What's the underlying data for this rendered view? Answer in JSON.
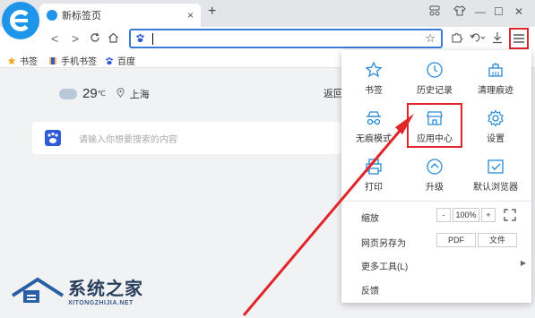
{
  "tab": {
    "title": "新标签页",
    "close": "×"
  },
  "new_tab": "+",
  "window_controls": [
    "⚇",
    "👕",
    "—",
    "☐",
    "✕"
  ],
  "nav": {
    "back": "<",
    "forward": ">",
    "refresh": "C",
    "home": "⌂",
    "star": "☆"
  },
  "bookmarks": [
    "书签",
    "手机书签",
    "百度"
  ],
  "weather": {
    "temp": "29",
    "unit": "℃",
    "city": "上海"
  },
  "page": {
    "back_label": "返回",
    "search_placeholder": "请输入你想要搜索的内容"
  },
  "menu": {
    "items": [
      {
        "label": "书签",
        "icon": "star-icon"
      },
      {
        "label": "历史记录",
        "icon": "clock-icon"
      },
      {
        "label": "清理痕迹",
        "icon": "broom-icon"
      },
      {
        "label": "无痕模式",
        "icon": "incognito-icon"
      },
      {
        "label": "应用中心",
        "icon": "store-icon"
      },
      {
        "label": "设置",
        "icon": "gear-icon"
      },
      {
        "label": "打印",
        "icon": "printer-icon"
      },
      {
        "label": "升级",
        "icon": "upgrade-icon"
      },
      {
        "label": "默认浏览器",
        "icon": "default-browser-icon"
      }
    ],
    "zoom": {
      "label": "缩放",
      "minus": "-",
      "value": "100%",
      "plus": "+"
    },
    "save_as": {
      "label": "网页另存为",
      "pdf": "PDF",
      "file": "文件"
    },
    "more_tools": "更多工具(L)",
    "feedback": "反馈"
  },
  "watermark": {
    "title": "系统之家",
    "subtitle": "XITONGZHIJIA.NET"
  },
  "colors": {
    "accent": "#1e95e8",
    "highlight": "#e0262a",
    "address_border": "#3a7bd5"
  }
}
